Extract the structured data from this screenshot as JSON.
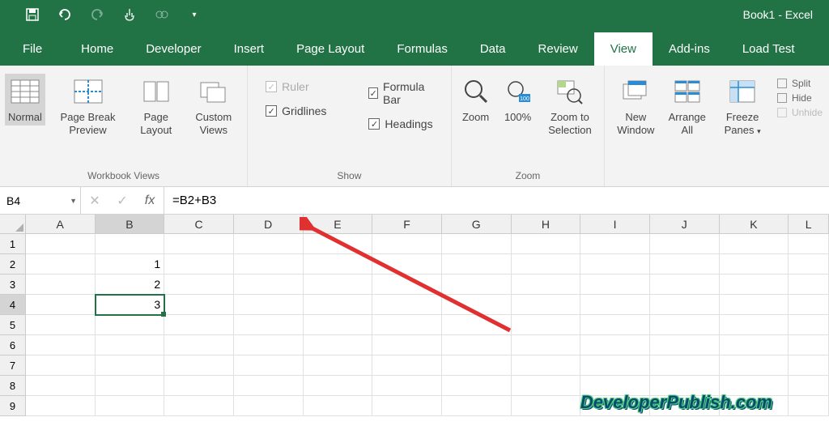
{
  "title": "Book1 - Excel",
  "tabs": [
    "File",
    "Home",
    "Developer",
    "Insert",
    "Page Layout",
    "Formulas",
    "Data",
    "Review",
    "View",
    "Add-ins",
    "Load Test"
  ],
  "active_tab": "View",
  "ribbon": {
    "workbook_views": {
      "label": "Workbook Views",
      "items": [
        "Normal",
        "Page Break Preview",
        "Page Layout",
        "Custom Views"
      ]
    },
    "show": {
      "label": "Show",
      "ruler": "Ruler",
      "gridlines": "Gridlines",
      "formula_bar": "Formula Bar",
      "headings": "Headings"
    },
    "zoom": {
      "label": "Zoom",
      "zoom": "Zoom",
      "hundred": "100%",
      "selection": "Zoom to Selection"
    },
    "window": {
      "new": "New Window",
      "arrange": "Arrange All",
      "freeze": "Freeze Panes",
      "split": "Split",
      "hide": "Hide",
      "unhide": "Unhide"
    }
  },
  "namebox": "B4",
  "formula": "=B2+B3",
  "columns": [
    "A",
    "B",
    "C",
    "D",
    "E",
    "F",
    "G",
    "H",
    "I",
    "J",
    "K",
    "L"
  ],
  "rows": [
    "1",
    "2",
    "3",
    "4",
    "5",
    "6",
    "7",
    "8",
    "9"
  ],
  "cells": {
    "B2": "1",
    "B3": "2",
    "B4": "3"
  },
  "selected_cell": "B4",
  "watermark": "DeveloperPublish.com",
  "chart_data": {
    "type": "table",
    "columns": [
      "A",
      "B",
      "C",
      "D",
      "E",
      "F",
      "G",
      "H",
      "I",
      "J",
      "K",
      "L"
    ],
    "data": {
      "B2": 1,
      "B3": 2,
      "B4": 3
    },
    "formulas": {
      "B4": "=B2+B3"
    },
    "selection": "B4"
  }
}
